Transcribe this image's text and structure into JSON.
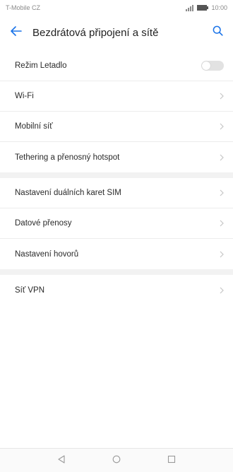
{
  "status_bar": {
    "carrier": "T-Mobile CZ",
    "time": "10:00"
  },
  "app_bar": {
    "title": "Bezdrátová připojení a sítě",
    "back_icon": "arrow-left-icon",
    "search_icon": "search-icon"
  },
  "colors": {
    "accent": "#1a73e8",
    "divider": "#ececec",
    "section_gap": "#f2f2f2",
    "chevron": "#c6c6c6"
  },
  "sections": [
    {
      "items": [
        {
          "label": "Režim Letadlo",
          "control": "toggle",
          "toggle_on": false
        },
        {
          "label": "Wi-Fi",
          "control": "chevron"
        },
        {
          "label": "Mobilní síť",
          "control": "chevron"
        },
        {
          "label": "Tethering a přenosný hotspot",
          "control": "chevron"
        }
      ]
    },
    {
      "items": [
        {
          "label": "Nastavení duálních karet SIM",
          "control": "chevron"
        },
        {
          "label": "Datové přenosy",
          "control": "chevron"
        },
        {
          "label": "Nastavení hovorů",
          "control": "chevron"
        }
      ]
    },
    {
      "items": [
        {
          "label": "Síť VPN",
          "control": "chevron"
        }
      ]
    }
  ],
  "nav_bar": {
    "back_icon": "triangle-back-icon",
    "home_icon": "circle-home-icon",
    "recents_icon": "square-recents-icon"
  }
}
